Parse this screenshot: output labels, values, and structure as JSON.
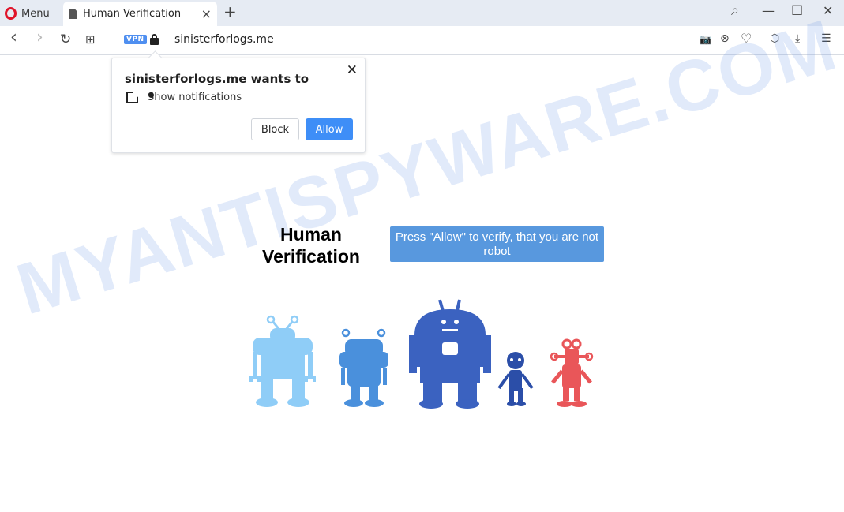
{
  "browser": {
    "menu_label": "Menu",
    "tab_title": "Human Verification",
    "url": "sinisterforlogs.me",
    "vpn_badge": "VPN",
    "icons": {
      "close_tab": "×",
      "new_tab": "+",
      "search": "⌕",
      "minimize": "—",
      "maximize": "☐",
      "close_window": "✕",
      "back": "‹",
      "forward": "›",
      "reload": "↻",
      "speed_dial": "⊞",
      "snapshot": "📷",
      "adblock": "⊗",
      "bookmark": "♡",
      "extensions": "⬡",
      "downloads": "⤓",
      "easy_setup": "☰"
    }
  },
  "popup": {
    "title": "sinisterforlogs.me wants to",
    "permission": "Show notifications",
    "close": "✕",
    "block_label": "Block",
    "allow_label": "Allow"
  },
  "page": {
    "heading": "Human Verification",
    "prompt": "Press \"Allow\" to verify, that you are not robot",
    "robot_colors": [
      "#8fcdf7",
      "#4a90dc",
      "#3b62c0",
      "#2b4ea8",
      "#e95659"
    ]
  },
  "watermark": "MYANTISPYWARE.COM"
}
